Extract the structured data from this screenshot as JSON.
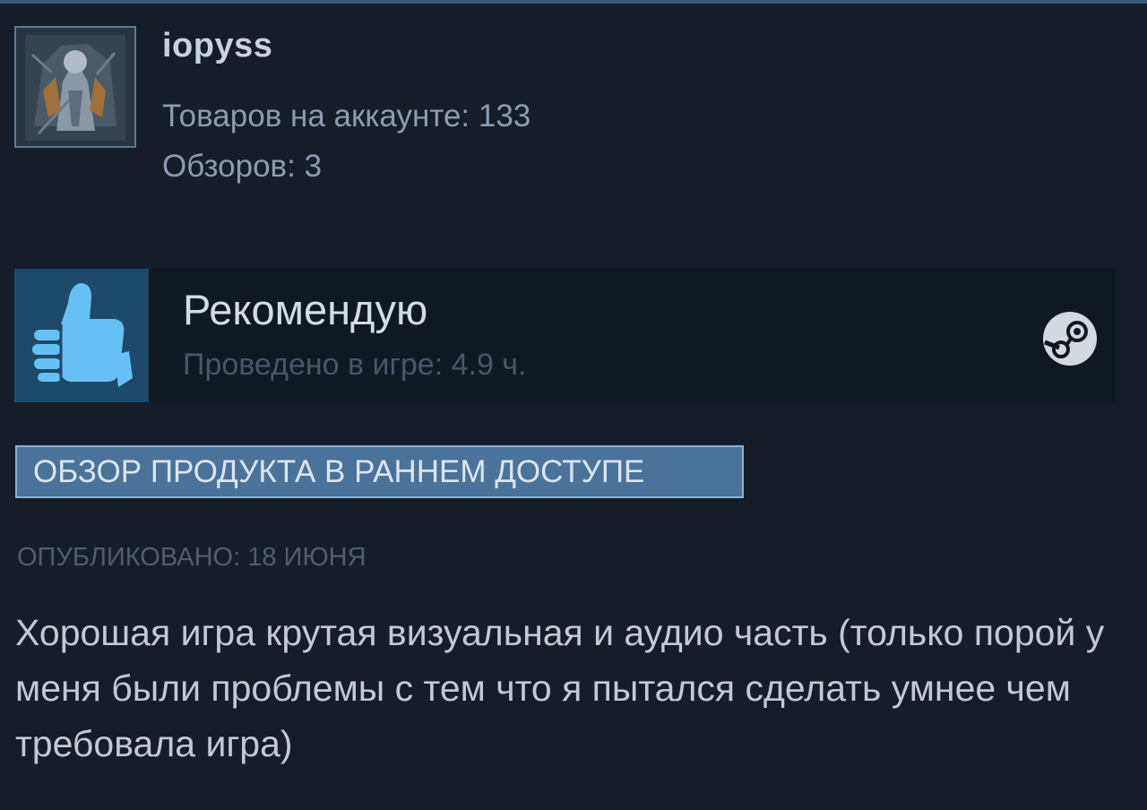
{
  "user": {
    "name": "iopyss",
    "products_on_account": "Товаров на аккаунте: 133",
    "reviews_count": "Обзоров: 3"
  },
  "recommendation": {
    "title": "Рекомендую",
    "hours": "Проведено в игре: 4.9 ч.",
    "icon": "thumbs-up-icon",
    "platform_icon": "steam-icon"
  },
  "review": {
    "badge": "ОБЗОР ПРОДУКТА В РАННЕМ ДОСТУПЕ",
    "posted": "ОПУБЛИКОВАНО: 18 ИЮНЯ",
    "text": "Хорошая игра крутая визуальная и аудио часть (только порой у меня были проблемы с тем что я пытался сделать умнее чем требовала игра)"
  },
  "colors": {
    "background": "#171d28",
    "thumb_tile": "#1d4a6a",
    "thumb": "#66c0f4",
    "badge_bg": "#4b7399"
  }
}
